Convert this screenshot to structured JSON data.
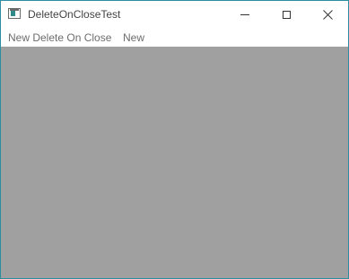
{
  "window": {
    "title": "DeleteOnCloseTest"
  },
  "menubar": {
    "items": [
      {
        "label": "New Delete On Close"
      },
      {
        "label": "New"
      }
    ]
  },
  "icons": {
    "app": "window-app-icon",
    "minimize": "minimize-icon",
    "maximize": "maximize-icon",
    "close": "close-icon"
  },
  "colors": {
    "client_background": "#a0a0a0",
    "window_border": "#2b8fa0"
  }
}
